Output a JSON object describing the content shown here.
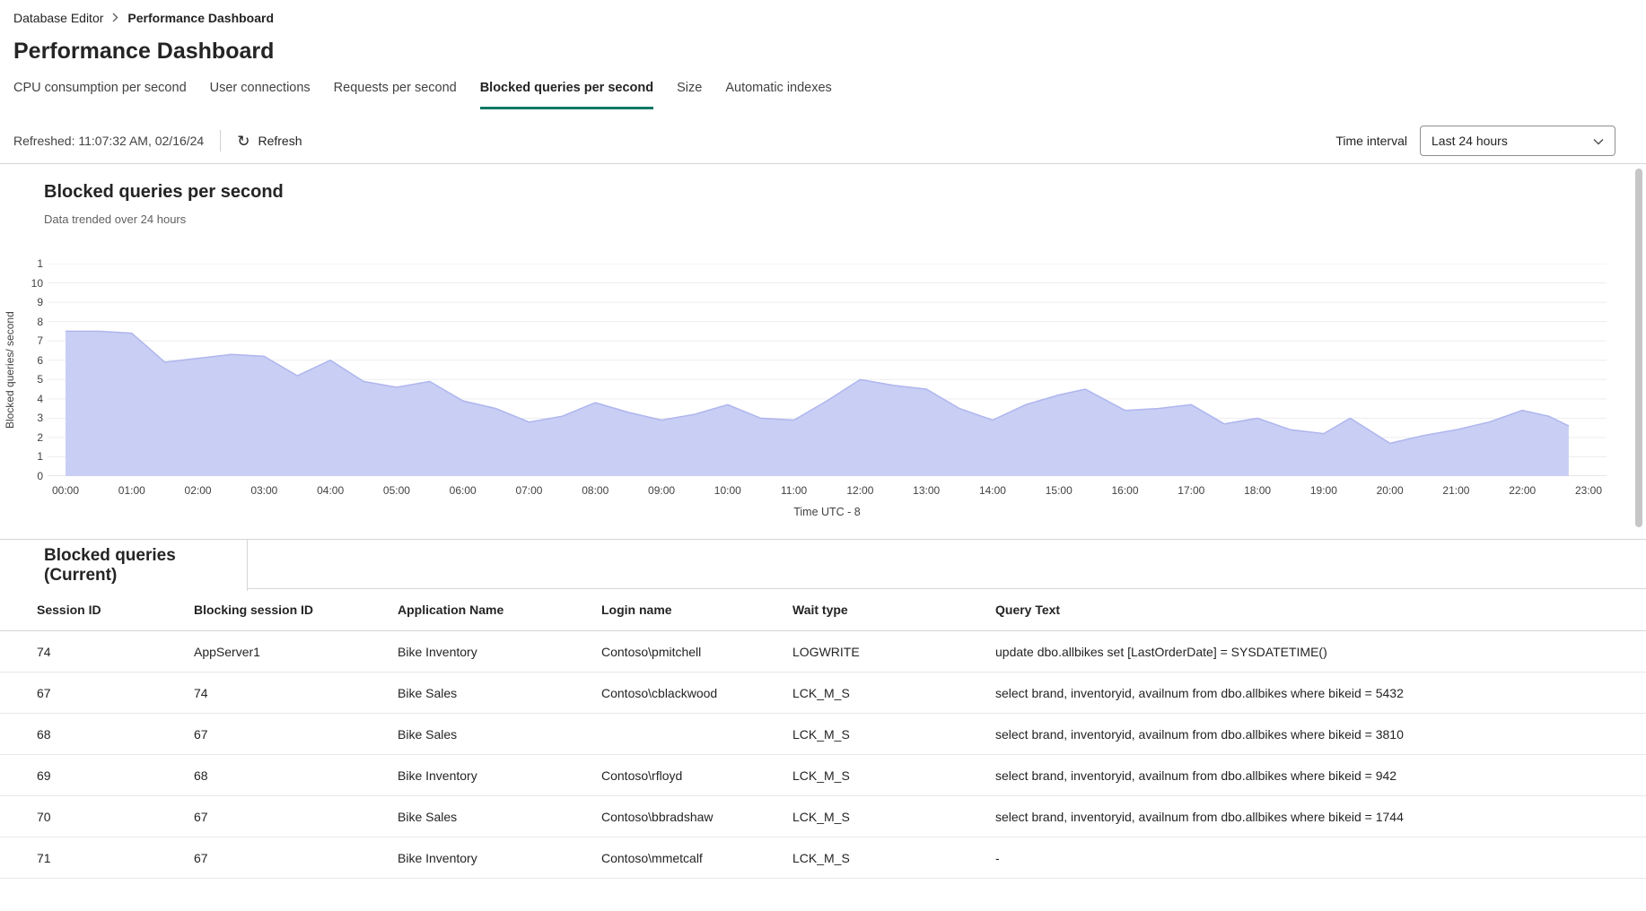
{
  "colors": {
    "accent": "#117865",
    "area_fill": "#c9cef4",
    "area_stroke": "#aeb6ee"
  },
  "breadcrumb": {
    "items": [
      "Database Editor",
      "Performance Dashboard"
    ]
  },
  "page": {
    "title": "Performance Dashboard"
  },
  "tabs": [
    {
      "label": "CPU consumption per second",
      "active": false
    },
    {
      "label": "User connections",
      "active": false
    },
    {
      "label": "Requests per second",
      "active": false
    },
    {
      "label": "Blocked queries per second",
      "active": true
    },
    {
      "label": "Size",
      "active": false
    },
    {
      "label": "Automatic indexes",
      "active": false
    }
  ],
  "toolbar": {
    "refreshed_text": "Refreshed: 11:07:32 AM, 02/16/24",
    "refresh_label": "Refresh",
    "time_interval_label": "Time interval",
    "time_interval_value": "Last 24 hours"
  },
  "chart_data": {
    "type": "area",
    "title": "Blocked queries per second",
    "subtitle": "Data trended over 24 hours",
    "ylabel": "Blocked queries/ second",
    "xlabel": "Time UTC - 8",
    "ylim": [
      0,
      11
    ],
    "grid": true,
    "y_tick_labels_top_to_bottom": [
      "1",
      "10",
      "9",
      "8",
      "7",
      "6",
      "5",
      "4",
      "3",
      "2",
      "1",
      "0"
    ],
    "x_tick_labels": [
      "00:00",
      "01:00",
      "02:00",
      "03:00",
      "04:00",
      "05:00",
      "06:00",
      "07:00",
      "08:00",
      "09:00",
      "10:00",
      "11:00",
      "12:00",
      "13:00",
      "14:00",
      "15:00",
      "16:00",
      "17:00",
      "18:00",
      "19:00",
      "20:00",
      "21:00",
      "22:00",
      "23:00"
    ],
    "series": [
      {
        "name": "Blocked queries/second",
        "points": [
          [
            0,
            7.5
          ],
          [
            0.5,
            7.5
          ],
          [
            1.0,
            7.4
          ],
          [
            1.5,
            5.9
          ],
          [
            2.0,
            6.1
          ],
          [
            2.5,
            6.3
          ],
          [
            3.0,
            6.2
          ],
          [
            3.5,
            5.2
          ],
          [
            4.0,
            6.0
          ],
          [
            4.5,
            4.9
          ],
          [
            5.0,
            4.6
          ],
          [
            5.5,
            4.9
          ],
          [
            6.0,
            3.9
          ],
          [
            6.5,
            3.5
          ],
          [
            7.0,
            2.8
          ],
          [
            7.5,
            3.1
          ],
          [
            8.0,
            3.8
          ],
          [
            8.5,
            3.3
          ],
          [
            9.0,
            2.9
          ],
          [
            9.5,
            3.2
          ],
          [
            10.0,
            3.7
          ],
          [
            10.5,
            3.0
          ],
          [
            11.0,
            2.9
          ],
          [
            11.5,
            3.9
          ],
          [
            12.0,
            5.0
          ],
          [
            12.5,
            4.7
          ],
          [
            13.0,
            4.5
          ],
          [
            13.5,
            3.5
          ],
          [
            14.0,
            2.9
          ],
          [
            14.5,
            3.7
          ],
          [
            15.0,
            4.2
          ],
          [
            15.4,
            4.5
          ],
          [
            16.0,
            3.4
          ],
          [
            16.5,
            3.5
          ],
          [
            17.0,
            3.7
          ],
          [
            17.5,
            2.7
          ],
          [
            18.0,
            3.0
          ],
          [
            18.5,
            2.4
          ],
          [
            19.0,
            2.2
          ],
          [
            19.4,
            3.0
          ],
          [
            20.0,
            1.7
          ],
          [
            20.5,
            2.1
          ],
          [
            21.0,
            2.4
          ],
          [
            21.5,
            2.8
          ],
          [
            22.0,
            3.4
          ],
          [
            22.4,
            3.1
          ],
          [
            22.7,
            2.6
          ]
        ]
      }
    ]
  },
  "table_section": {
    "title": "Blocked queries (Current)"
  },
  "table": {
    "columns": [
      "Session ID",
      "Blocking session ID",
      "Application Name",
      "Login name",
      "Wait type",
      "Query Text"
    ],
    "rows": [
      [
        "74",
        "AppServer1",
        "Bike Inventory",
        "Contoso\\pmitchell",
        "LOGWRITE",
        "update  dbo.allbikes  set [LastOrderDate] = SYSDATETIME()"
      ],
      [
        "67",
        "74",
        "Bike Sales",
        "Contoso\\cblackwood",
        "LCK_M_S",
        "select brand, inventoryid, availnum  from dbo.allbikes where bikeid = 5432"
      ],
      [
        "68",
        "67",
        "Bike Sales",
        "",
        "LCK_M_S",
        "select brand, inventoryid, availnum  from dbo.allbikes where bikeid = 3810"
      ],
      [
        "69",
        "68",
        "Bike Inventory",
        "Contoso\\rfloyd",
        "LCK_M_S",
        "select brand, inventoryid, availnum  from dbo.allbikes where bikeid = 942"
      ],
      [
        "70",
        "67",
        "Bike Sales",
        "Contoso\\bbradshaw",
        "LCK_M_S",
        "select brand, inventoryid, availnum  from dbo.allbikes where bikeid = 1744"
      ],
      [
        "71",
        "67",
        "Bike Inventory",
        "Contoso\\mmetcalf",
        "LCK_M_S",
        "-"
      ]
    ]
  }
}
